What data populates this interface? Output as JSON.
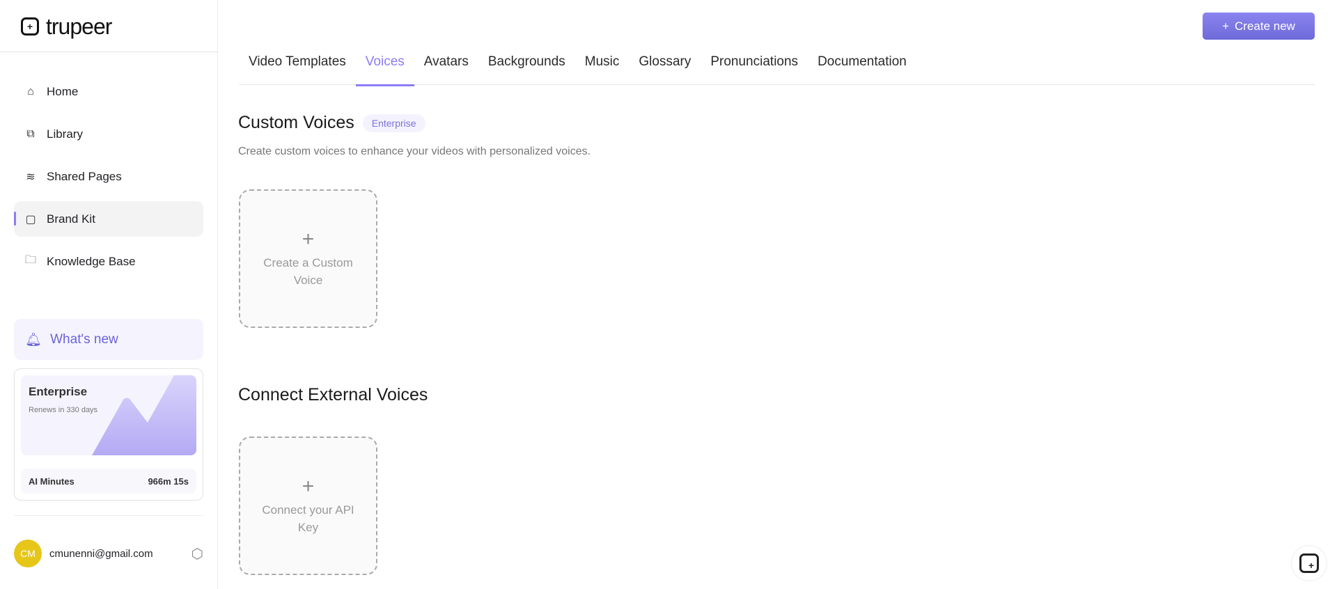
{
  "app": {
    "logo_text": "trupeer"
  },
  "sidebar": {
    "items": [
      {
        "label": "Home",
        "icon": "home-icon"
      },
      {
        "label": "Library",
        "icon": "library-icon"
      },
      {
        "label": "Shared Pages",
        "icon": "layers-icon"
      },
      {
        "label": "Brand Kit",
        "icon": "brand-kit-icon",
        "active": true
      },
      {
        "label": "Knowledge Base",
        "icon": "folder-icon"
      }
    ],
    "whats_new": "What's new",
    "plan": {
      "name": "Enterprise",
      "renews": "Renews in 330 days",
      "minutes_label": "AI Minutes",
      "minutes_value": "966m 15s"
    },
    "user": {
      "initials": "CM",
      "email": "cmunenni@gmail.com"
    }
  },
  "header": {
    "create_label": "Create new"
  },
  "tabs": [
    "Video Templates",
    "Voices",
    "Avatars",
    "Backgrounds",
    "Music",
    "Glossary",
    "Pronunciations",
    "Documentation"
  ],
  "active_tab": "Voices",
  "custom": {
    "title": "Custom Voices",
    "badge": "Enterprise",
    "desc": "Create custom voices to enhance your videos with personalized voices.",
    "card_label": "Create a Custom Voice"
  },
  "external": {
    "title": "Connect External Voices",
    "card_label": "Connect your API Key"
  },
  "colors": {
    "accent": "#8b7cf6",
    "avatar": "#e6c619"
  }
}
